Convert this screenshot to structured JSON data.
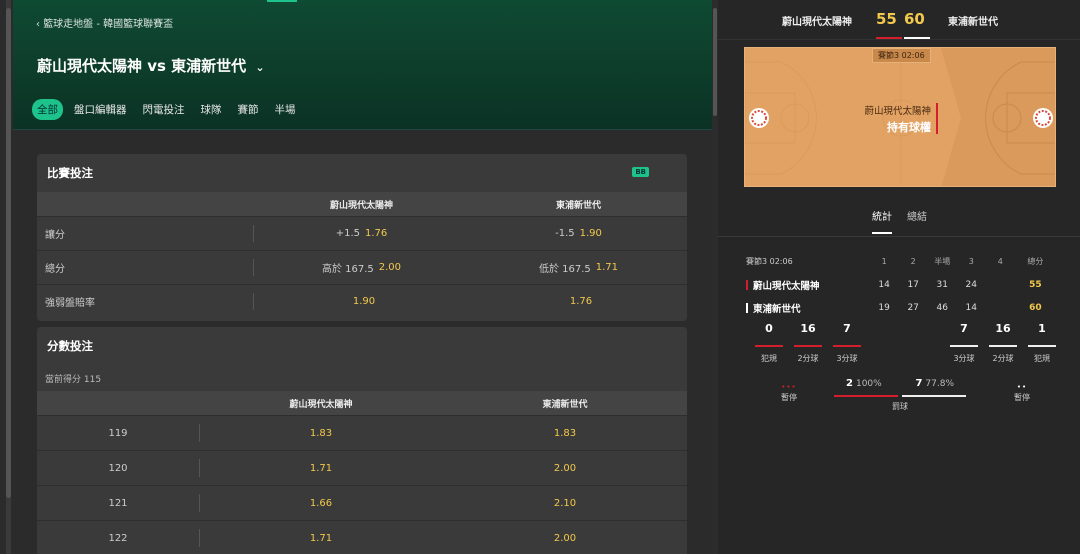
{
  "breadcrumb": "籃球走地盤 - 韓國籃球聯賽盃",
  "match": {
    "title": "蔚山現代太陽神 vs 東浦新世代",
    "home": "蔚山現代太陽神",
    "away": "東浦新世代"
  },
  "tabs": [
    "全部",
    "盤口編輯器",
    "閃電投注",
    "球隊",
    "賽節",
    "半場"
  ],
  "match_bet": {
    "title": "比賽投注",
    "badge": "BB",
    "home_col": "蔚山現代太陽神",
    "away_col": "東浦新世代",
    "rows": [
      {
        "label": "讓分",
        "home_line": "+1.5",
        "home_odds": "1.76",
        "away_line": "-1.5",
        "away_odds": "1.90"
      },
      {
        "label": "總分",
        "home_line": "高於 167.5",
        "home_odds": "2.00",
        "away_line": "低於 167.5",
        "away_odds": "1.71"
      },
      {
        "label": "強弱盤賠率",
        "home_line": "",
        "home_odds": "1.90",
        "away_line": "",
        "away_odds": "1.76"
      }
    ]
  },
  "score_bet": {
    "title": "分數投注",
    "current": "當前得分 115",
    "home_col": "蔚山現代太陽神",
    "away_col": "東浦新世代",
    "rows": [
      {
        "points": "119",
        "home": "1.83",
        "away": "1.83"
      },
      {
        "points": "120",
        "home": "1.71",
        "away": "2.00"
      },
      {
        "points": "121",
        "home": "1.66",
        "away": "2.10"
      },
      {
        "points": "122",
        "home": "1.71",
        "away": "2.00"
      }
    ]
  },
  "scoreboard": {
    "home": "蔚山現代太陽神",
    "away": "東浦新世代",
    "home_score": "55",
    "away_score": "60"
  },
  "court": {
    "clock": "賽節3  02:06",
    "possession_team": "蔚山現代太陽神",
    "possession_label": "持有球權"
  },
  "stats_tabs": [
    "統計",
    "總結"
  ],
  "box": {
    "period": "賽節3 02:06",
    "headers": [
      "1",
      "2",
      "半場",
      "3",
      "4",
      "總分"
    ],
    "home": {
      "name": "蔚山現代太陽神",
      "q": [
        "14",
        "17",
        "31",
        "24",
        ""
      ],
      "total": "55",
      "color": "#d21f2b"
    },
    "away": {
      "name": "東浦新世代",
      "q": [
        "19",
        "27",
        "46",
        "14",
        ""
      ],
      "total": "60",
      "color": "#ffffff"
    }
  },
  "team_stats": {
    "home": [
      {
        "value": "0",
        "label": "犯規"
      },
      {
        "value": "16",
        "label": "2分球"
      },
      {
        "value": "7",
        "label": "3分球"
      }
    ],
    "away": [
      {
        "value": "7",
        "label": "3分球"
      },
      {
        "value": "16",
        "label": "2分球"
      },
      {
        "value": "1",
        "label": "犯規"
      }
    ]
  },
  "timeouts": {
    "home_dots": "•••",
    "away_dots": "••",
    "label": "暫停"
  },
  "free_throws": {
    "home": "2",
    "home_pct": "100%",
    "away": "7",
    "away_pct": "77.8%",
    "label": "罰球"
  },
  "colors": {
    "accent": "#1ec28b",
    "odds": "#f2c94c",
    "home": "#d21f2b",
    "away": "#ffffff"
  }
}
